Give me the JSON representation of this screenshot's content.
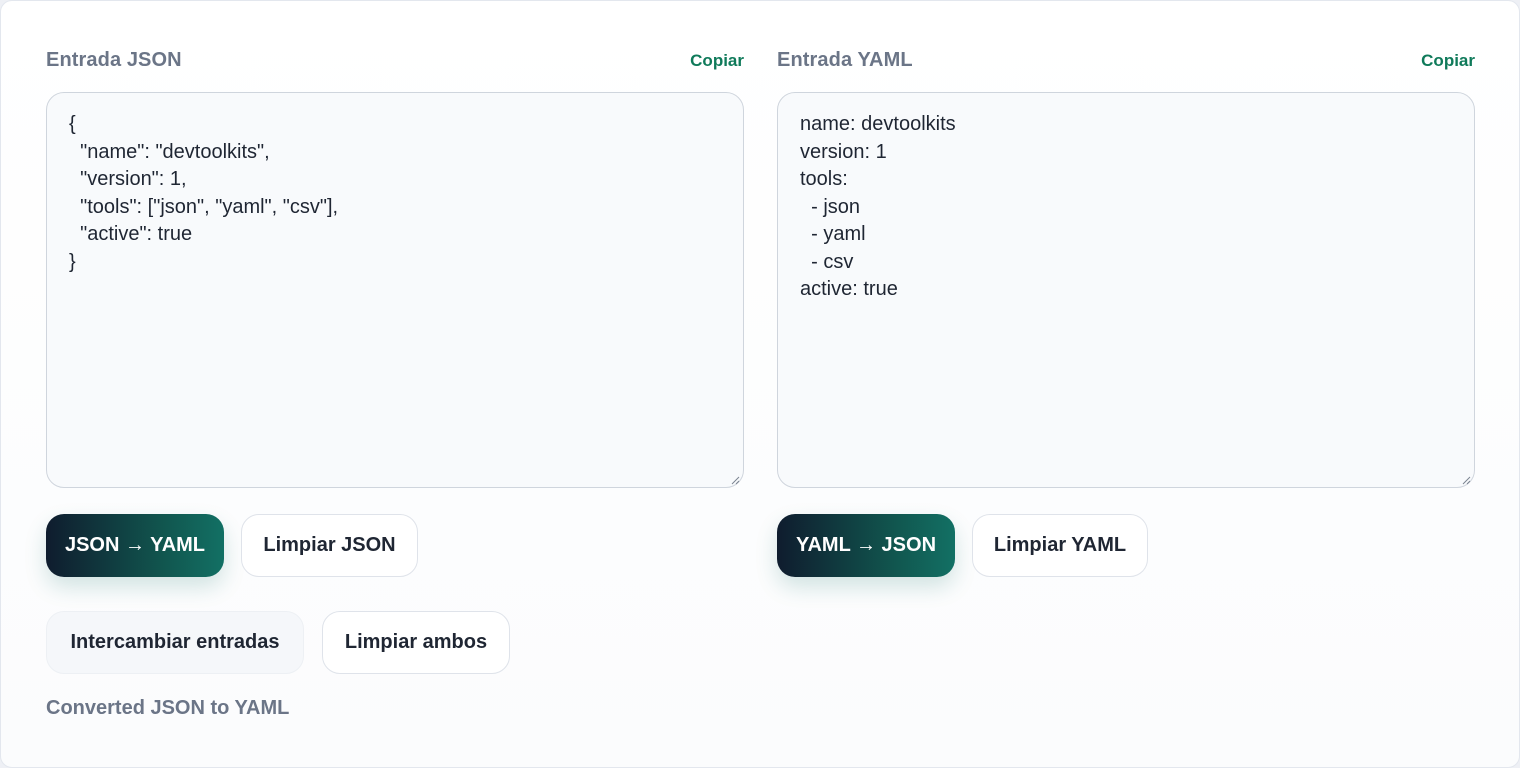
{
  "json_panel": {
    "title": "Entrada JSON",
    "copy_label": "Copiar",
    "content": "{\n  \"name\": \"devtoolkits\",\n  \"version\": 1,\n  \"tools\": [\"json\", \"yaml\", \"csv\"],\n  \"active\": true\n}",
    "convert_label": "JSON → YAML",
    "clear_label": "Limpiar JSON"
  },
  "yaml_panel": {
    "title": "Entrada YAML",
    "copy_label": "Copiar",
    "content": "name: devtoolkits\nversion: 1\ntools:\n  - json\n  - yaml\n  - csv\nactive: true",
    "convert_label": "YAML → JSON",
    "clear_label": "Limpiar YAML"
  },
  "actions": {
    "swap_label": "Intercambiar entradas",
    "clear_both_label": "Limpiar ambos"
  },
  "status_message": "Converted JSON to YAML",
  "colors": {
    "accent": "#0f7a5a",
    "primary_gradient_start": "#0f1c2e",
    "primary_gradient_end": "#127064",
    "muted_text": "#6b7587"
  },
  "icons": {
    "resize_grip": "resize-grip-icon"
  }
}
